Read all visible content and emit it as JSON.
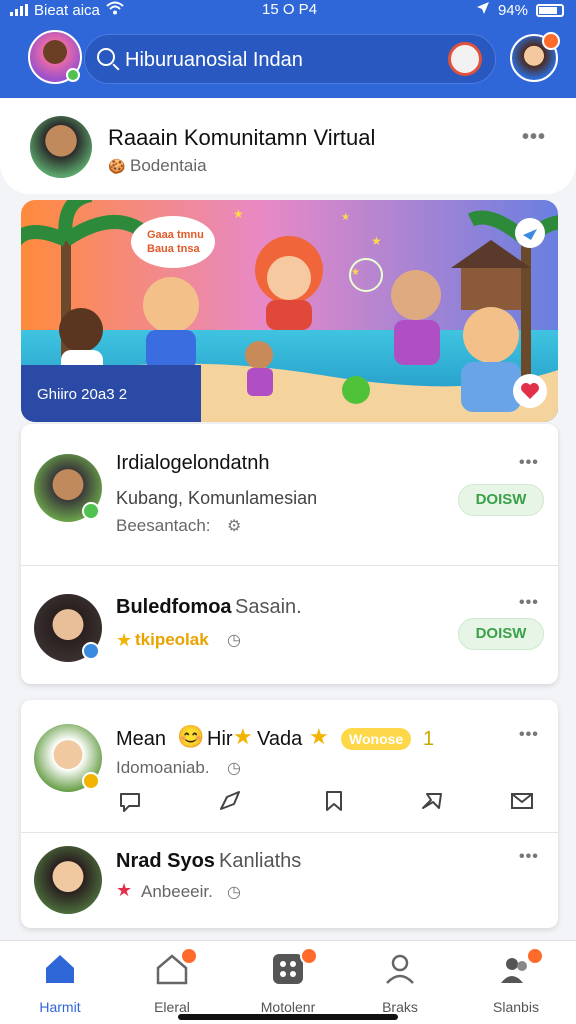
{
  "status_bar": {
    "carrier": "Bieat aica",
    "time": "15 O P4",
    "battery": "94%"
  },
  "header": {
    "search_text": "Hiburuanosial Indan"
  },
  "community": {
    "title": "Raaain Komunitamn Virtual",
    "subtitle": "Bodentaia",
    "more": "•••"
  },
  "banner": {
    "speech_line1": "Gaaa tmnu",
    "speech_line2": "Baua tnsa",
    "caption": "Ghiiro 20a3 2"
  },
  "people": [
    {
      "name": "Irdialogelondatnh",
      "line1": "Kubang, Komunlamesian",
      "line2": "Beesantach:",
      "button": "DOISW"
    },
    {
      "name": "Buledfomoa",
      "name_suffix": "Sasain.",
      "line1": "tkipeolak",
      "button": "DOISW"
    }
  ],
  "posts": [
    {
      "name": "Mean",
      "name_mid": "Hir",
      "name_end": "Vada",
      "tag": "Wonose",
      "count": "1",
      "sub": "Idomoaniab."
    },
    {
      "name": "Nrad Syos",
      "name_suffix": "Kanliaths",
      "sub": "Anbeeeir."
    }
  ],
  "bottom_nav": [
    {
      "label": "Harmit",
      "icon": "home-icon",
      "active": true
    },
    {
      "label": "Eleral",
      "icon": "house-icon"
    },
    {
      "label": "Motolenr",
      "icon": "apps-icon"
    },
    {
      "label": "Braks",
      "icon": "profile-icon"
    },
    {
      "label": "Slanbis",
      "icon": "people-icon"
    }
  ],
  "colors": {
    "brand": "#2f67d8",
    "follow_green": "#3aa14a",
    "notification": "#ff6b2b",
    "gold": "#f2b400"
  }
}
